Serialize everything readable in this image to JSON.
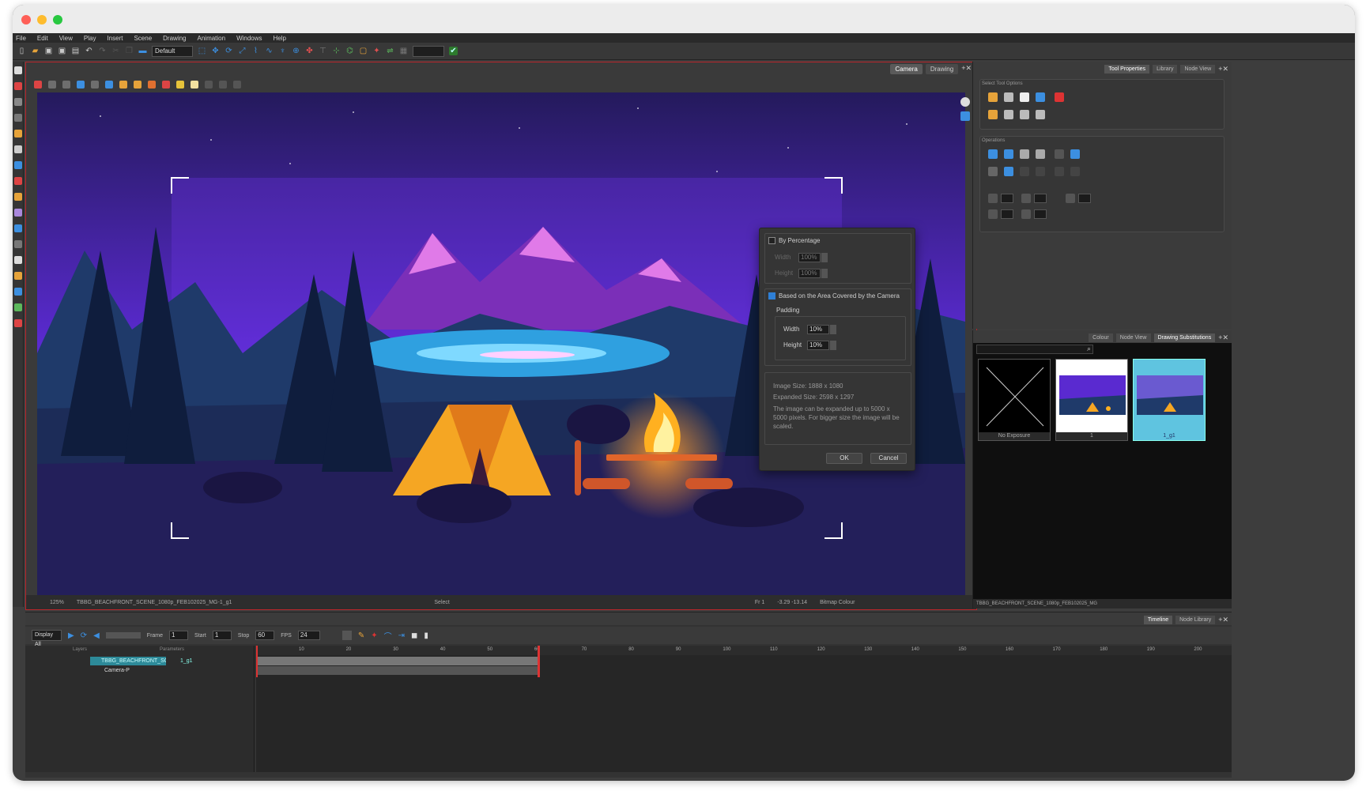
{
  "menu": [
    "File",
    "Edit",
    "View",
    "Play",
    "Insert",
    "Scene",
    "Drawing",
    "Animation",
    "Windows",
    "Help"
  ],
  "toolbar": {
    "workspace_combo": "Default"
  },
  "viewport": {
    "tabs": [
      "Camera",
      "Drawing"
    ],
    "status": {
      "zoom": "125%",
      "drawing_name": "TBBG_BEACHFRONT_SCENE_1080p_FEB102025_MG-1_g1",
      "mode": "Select",
      "frame": "Fr 1",
      "coords": "-3.29 -13.14",
      "colour_mode": "Bitmap Colour"
    }
  },
  "dialog": {
    "by_percentage_label": "By Percentage",
    "width_label": "Width",
    "height_label": "Height",
    "pct_width": "100%",
    "pct_height": "100%",
    "camera_label": "Based on the Area Covered by the Camera",
    "padding_label": "Padding",
    "pad_width_label": "Width",
    "pad_height_label": "Height",
    "pad_width": "10%",
    "pad_height": "10%",
    "image_size": "Image Size:   1888 x 1080",
    "expanded_size": "Expanded Size:  2598 x 1297",
    "note": "The image can be expanded up to 5000 x 5000 pixels. For bigger size the image will be scaled.",
    "ok": "OK",
    "cancel": "Cancel"
  },
  "tool_properties": {
    "tabs": [
      "Tool Properties",
      "Library",
      "Node View"
    ],
    "select_options": "Select Tool Options",
    "operations": "Operations"
  },
  "substitutions": {
    "tabs": [
      "Colour",
      "Node View",
      "Drawing Substitutions"
    ],
    "thumbs": [
      "No Exposure",
      "1",
      "1_g1"
    ],
    "footer": "TBBG_BEACHFRONT_SCENE_1080p_FEB102025_MG"
  },
  "timeline": {
    "tabs": [
      "Timeline",
      "Node Library"
    ],
    "display": "Display All",
    "frame_label": "Frame",
    "frame_value": "1",
    "start_label": "Start",
    "start_value": "1",
    "stop_label": "Stop",
    "stop_value": "60",
    "fps_label": "FPS",
    "fps_value": "24",
    "layers_header": "Layers",
    "params_header": "Parameters",
    "layers": [
      "TBBG_BEACHFRONT_SCENE_...",
      "Camera-P"
    ],
    "layer_drawing": "1_g1",
    "ruler": [
      "10",
      "20",
      "30",
      "40",
      "50",
      "60",
      "70",
      "80",
      "90",
      "100",
      "110",
      "120",
      "130",
      "140",
      "150",
      "160",
      "170",
      "180",
      "190",
      "200"
    ]
  }
}
